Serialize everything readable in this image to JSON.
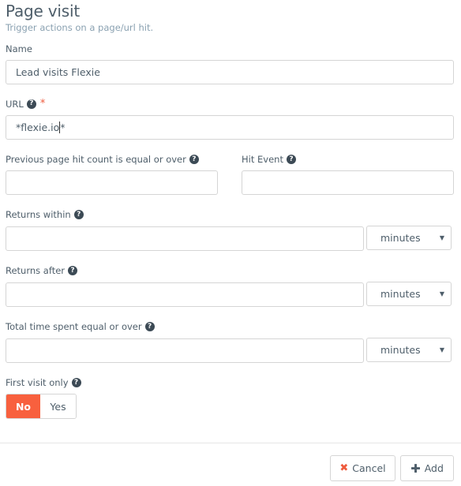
{
  "header": {
    "title": "Page visit",
    "subtitle": "Trigger actions on a page/url hit."
  },
  "fields": {
    "name": {
      "label": "Name",
      "value": "Lead visits Flexie"
    },
    "url": {
      "label": "URL",
      "required_mark": "*",
      "value_before_cursor": "*flexie.io",
      "value_after_cursor": "*"
    },
    "prev_hit_count": {
      "label": "Previous page hit count is equal or over",
      "value": ""
    },
    "hit_event": {
      "label": "Hit Event",
      "value": ""
    },
    "returns_within": {
      "label": "Returns within",
      "value": "",
      "unit": "minutes"
    },
    "returns_after": {
      "label": "Returns after",
      "value": "",
      "unit": "minutes"
    },
    "total_time": {
      "label": "Total time spent equal or over",
      "value": "",
      "unit": "minutes"
    },
    "first_visit_only": {
      "label": "First visit only",
      "options": [
        "No",
        "Yes"
      ],
      "selected": "No"
    }
  },
  "icons": {
    "help": "?",
    "caret": "▼",
    "cancel": "✖",
    "add": "✚"
  },
  "footer": {
    "cancel_label": "Cancel",
    "add_label": "Add"
  },
  "colors": {
    "accent": "#f8603e",
    "required": "#ee5b3d"
  }
}
